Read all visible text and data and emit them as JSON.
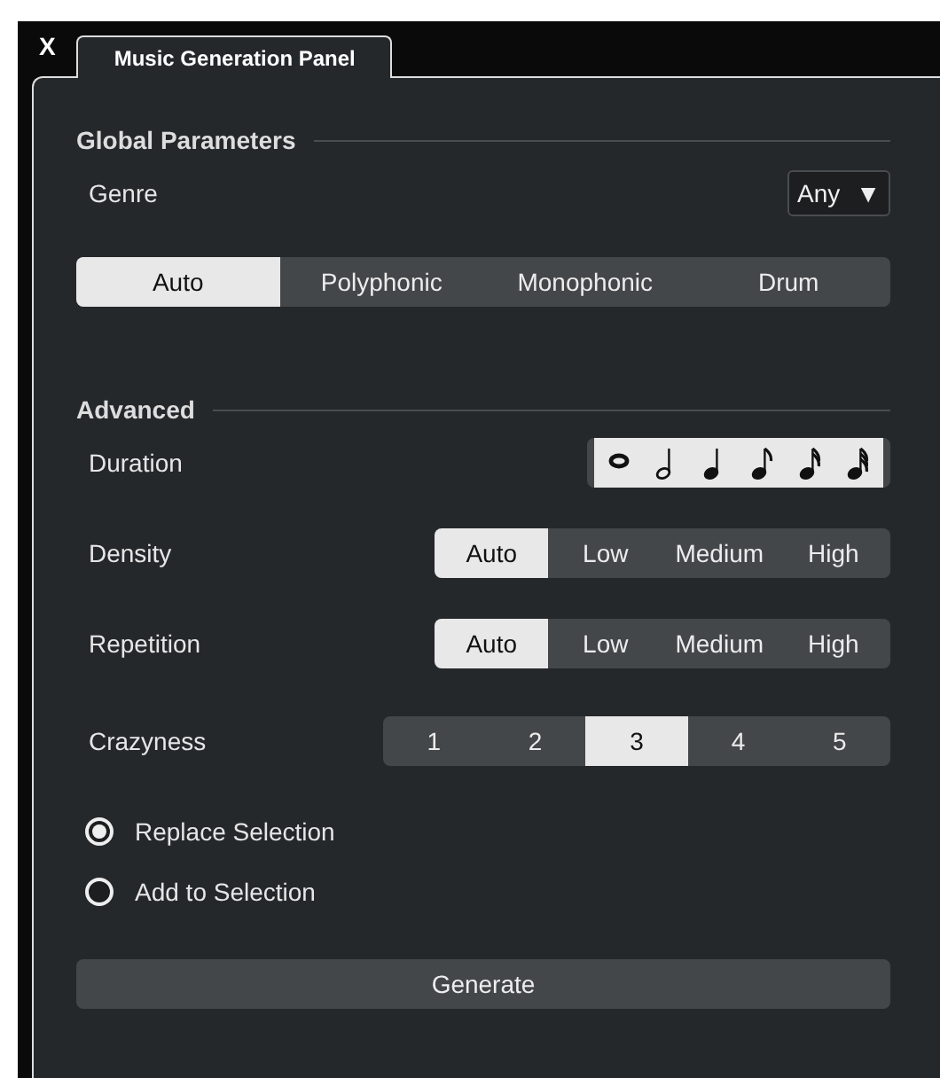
{
  "close_label": "X",
  "tab": {
    "label": "Music Generation Panel",
    "selected": true
  },
  "global": {
    "heading": "Global Parameters",
    "genre": {
      "label": "Genre",
      "value": "Any",
      "caret": "▼"
    },
    "mode": [
      {
        "label": "Auto",
        "selected": true
      },
      {
        "label": "Polyphonic",
        "selected": false
      },
      {
        "label": "Monophonic",
        "selected": false
      },
      {
        "label": "Drum",
        "selected": false
      }
    ]
  },
  "advanced": {
    "heading": "Advanced",
    "duration": {
      "label": "Duration",
      "notes": [
        {
          "kind": "whole",
          "selected": true
        },
        {
          "kind": "half",
          "selected": true
        },
        {
          "kind": "quarter",
          "selected": true
        },
        {
          "kind": "eighth",
          "selected": true
        },
        {
          "kind": "sixteenth",
          "selected": true
        },
        {
          "kind": "thirtysecond",
          "selected": true
        }
      ]
    },
    "rows": [
      {
        "label": "Density",
        "options": [
          {
            "label": "Auto",
            "selected": true
          },
          {
            "label": "Low",
            "selected": false
          },
          {
            "label": "Medium",
            "selected": false
          },
          {
            "label": "High",
            "selected": false
          }
        ]
      },
      {
        "label": "Repetition",
        "options": [
          {
            "label": "Auto",
            "selected": true
          },
          {
            "label": "Low",
            "selected": false
          },
          {
            "label": "Medium",
            "selected": false
          },
          {
            "label": "High",
            "selected": false
          }
        ]
      },
      {
        "label": "Crazyness",
        "options": [
          {
            "label": "1",
            "selected": false
          },
          {
            "label": "2",
            "selected": false
          },
          {
            "label": "3",
            "selected": true
          },
          {
            "label": "4",
            "selected": false
          },
          {
            "label": "5",
            "selected": false
          }
        ]
      }
    ]
  },
  "placement": [
    {
      "label": "Replace Selection",
      "selected": true
    },
    {
      "label": "Add to Selection",
      "selected": false
    }
  ],
  "generate": "Generate"
}
